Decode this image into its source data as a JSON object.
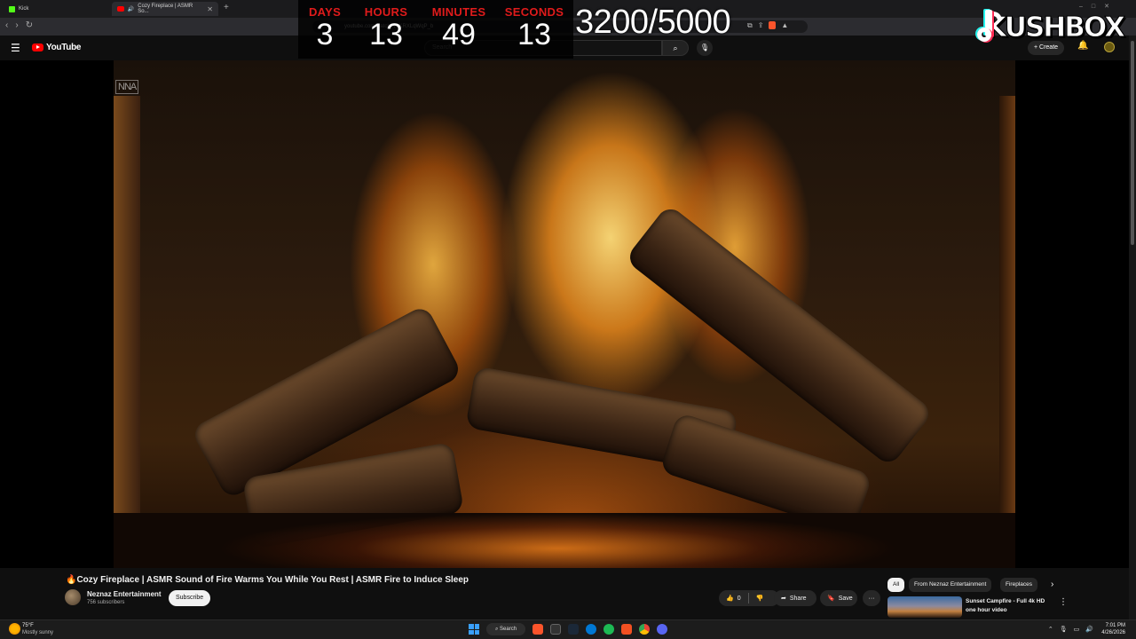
{
  "browser": {
    "tabs": [
      {
        "label": "Kick"
      },
      {
        "label": "Cozy Fireplace | ASMR So..."
      }
    ],
    "new_tab": "+",
    "url": "youtube.com/watch?v=KRXLqWqP_b"
  },
  "youtube": {
    "logo_text": "YouTube",
    "search_placeholder": "Search",
    "create_label": "+ Create"
  },
  "overlay": {
    "countdown": {
      "days_label": "DAYS",
      "days_value": "3",
      "hours_label": "HOURS",
      "hours_value": "13",
      "minutes_label": "MINUTES",
      "minutes_value": "49",
      "seconds_label": "SECONDS",
      "seconds_value": "13"
    },
    "goal_counter": "3200/5000",
    "brand_text": "KUSHBOX"
  },
  "video": {
    "watermark": "NNA",
    "title": "🔥Cozy Fireplace | ASMR Sound of Fire Warms You While You Rest | ASMR Fire to Induce Sleep",
    "channel_name": "Neznaz Entertainment",
    "subscribers": "756 subscribers",
    "subscribe_label": "Subscribe",
    "like_count": "0",
    "share_label": "Share",
    "save_label": "Save",
    "more_label": "···"
  },
  "sidebar": {
    "chips": [
      {
        "label": "All"
      },
      {
        "label": "From Neznaz Entertainment"
      },
      {
        "label": "Fireplaces"
      }
    ],
    "recommendation": {
      "title": "Sunset Campfire - Full 4k HD one hour video"
    }
  },
  "taskbar": {
    "weather_temp": "75°F",
    "weather_desc": "Mostly sunny",
    "search_label": "Search",
    "time": "7:01 PM",
    "date": "4/26/2026"
  },
  "colors": {
    "countdown_label": "#e01b1b",
    "youtube_red": "#ff0000",
    "background": "#0f0f0f"
  }
}
